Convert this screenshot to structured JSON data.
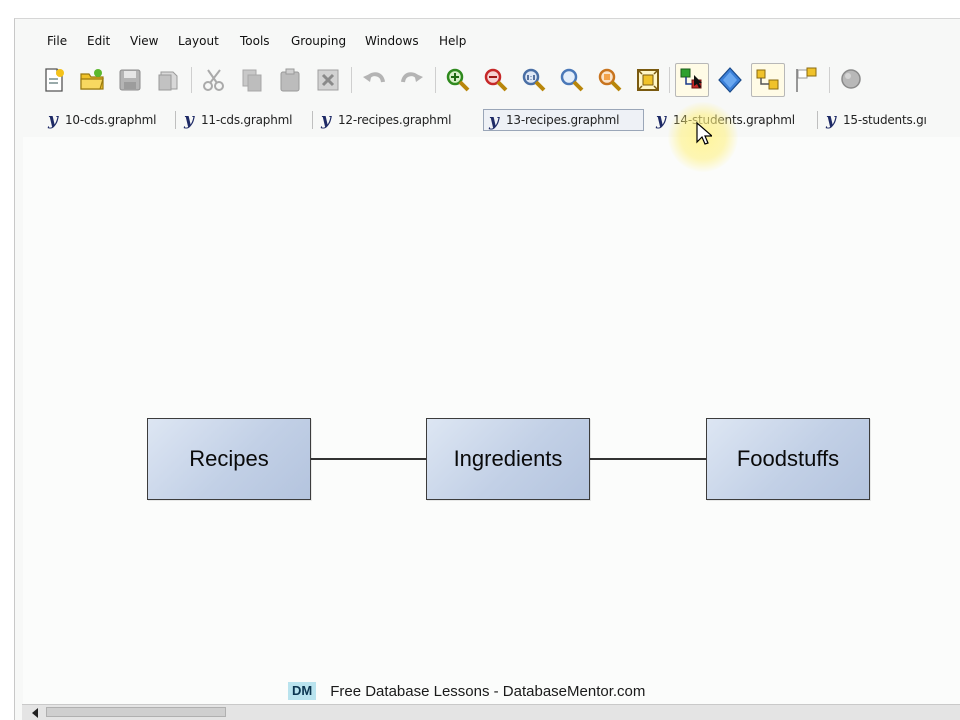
{
  "menu": {
    "items": [
      "File",
      "Edit",
      "View",
      "Layout",
      "Tools",
      "Grouping",
      "Windows",
      "Help"
    ]
  },
  "toolbar": {
    "buttons": [
      {
        "icon": "new-document-icon"
      },
      {
        "icon": "open-folder-icon"
      },
      {
        "icon": "save-icon"
      },
      {
        "icon": "properties-icon"
      },
      {
        "icon": "cut-icon"
      },
      {
        "icon": "copy-icon"
      },
      {
        "icon": "paste-icon"
      },
      {
        "icon": "delete-icon"
      },
      {
        "icon": "undo-icon"
      },
      {
        "icon": "redo-icon"
      },
      {
        "icon": "zoom-in-icon"
      },
      {
        "icon": "zoom-out-icon"
      },
      {
        "icon": "zoom-actual-size-icon"
      },
      {
        "icon": "zoom-icon"
      },
      {
        "icon": "zoom-area-icon"
      },
      {
        "icon": "fit-content-icon"
      },
      {
        "icon": "edit-mode-icon",
        "active": true
      },
      {
        "icon": "navigation-mode-icon"
      },
      {
        "icon": "group-icon",
        "active": true
      },
      {
        "icon": "flag-icon"
      },
      {
        "icon": "magnifier-icon"
      }
    ]
  },
  "tabs": {
    "items": [
      {
        "label": "10-cds.graphml"
      },
      {
        "label": "11-cds.graphml"
      },
      {
        "label": "12-recipes.graphml"
      },
      {
        "label": "13-recipes.graphml",
        "selected": true
      },
      {
        "label": "14-students.graphml"
      },
      {
        "label": "15-students.gı"
      }
    ]
  },
  "diagram": {
    "nodes": [
      {
        "label": "Recipes"
      },
      {
        "label": "Ingredients"
      },
      {
        "label": "Foodstuffs"
      }
    ],
    "node_fill": "#c6d3e8",
    "node_border": "#3c3c3c"
  },
  "watermark": {
    "badge": "DM",
    "text": "Free Database Lessons - DatabaseMentor.com"
  }
}
